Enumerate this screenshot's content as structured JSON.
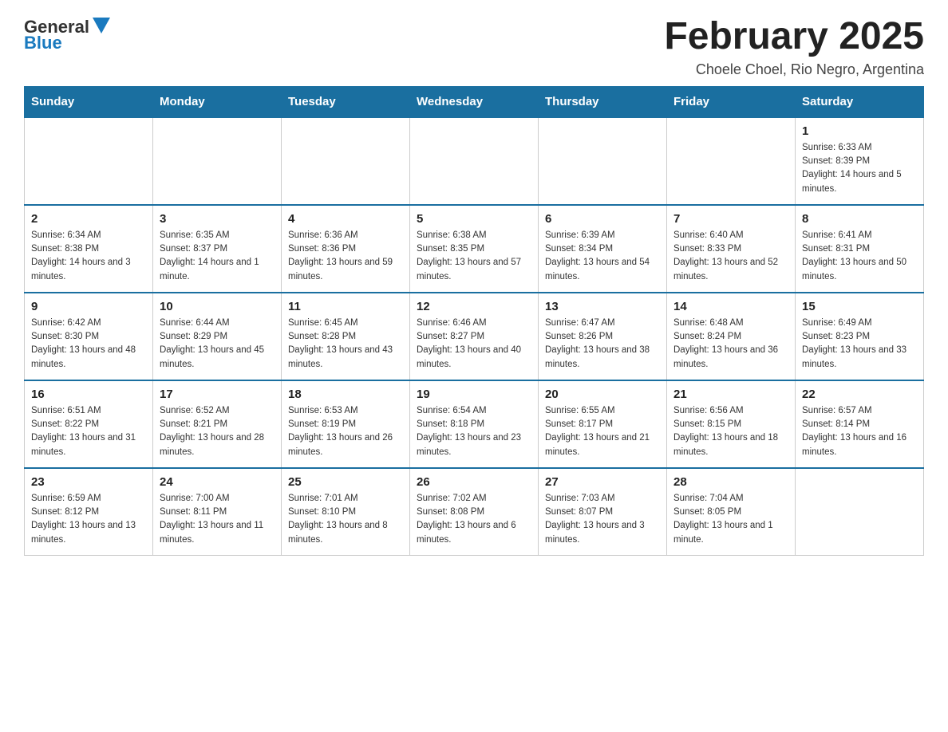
{
  "header": {
    "logo_general": "General",
    "logo_blue": "Blue",
    "month_title": "February 2025",
    "location": "Choele Choel, Rio Negro, Argentina"
  },
  "weekdays": [
    "Sunday",
    "Monday",
    "Tuesday",
    "Wednesday",
    "Thursday",
    "Friday",
    "Saturday"
  ],
  "weeks": [
    [
      {
        "day": "",
        "info": ""
      },
      {
        "day": "",
        "info": ""
      },
      {
        "day": "",
        "info": ""
      },
      {
        "day": "",
        "info": ""
      },
      {
        "day": "",
        "info": ""
      },
      {
        "day": "",
        "info": ""
      },
      {
        "day": "1",
        "info": "Sunrise: 6:33 AM\nSunset: 8:39 PM\nDaylight: 14 hours and 5 minutes."
      }
    ],
    [
      {
        "day": "2",
        "info": "Sunrise: 6:34 AM\nSunset: 8:38 PM\nDaylight: 14 hours and 3 minutes."
      },
      {
        "day": "3",
        "info": "Sunrise: 6:35 AM\nSunset: 8:37 PM\nDaylight: 14 hours and 1 minute."
      },
      {
        "day": "4",
        "info": "Sunrise: 6:36 AM\nSunset: 8:36 PM\nDaylight: 13 hours and 59 minutes."
      },
      {
        "day": "5",
        "info": "Sunrise: 6:38 AM\nSunset: 8:35 PM\nDaylight: 13 hours and 57 minutes."
      },
      {
        "day": "6",
        "info": "Sunrise: 6:39 AM\nSunset: 8:34 PM\nDaylight: 13 hours and 54 minutes."
      },
      {
        "day": "7",
        "info": "Sunrise: 6:40 AM\nSunset: 8:33 PM\nDaylight: 13 hours and 52 minutes."
      },
      {
        "day": "8",
        "info": "Sunrise: 6:41 AM\nSunset: 8:31 PM\nDaylight: 13 hours and 50 minutes."
      }
    ],
    [
      {
        "day": "9",
        "info": "Sunrise: 6:42 AM\nSunset: 8:30 PM\nDaylight: 13 hours and 48 minutes."
      },
      {
        "day": "10",
        "info": "Sunrise: 6:44 AM\nSunset: 8:29 PM\nDaylight: 13 hours and 45 minutes."
      },
      {
        "day": "11",
        "info": "Sunrise: 6:45 AM\nSunset: 8:28 PM\nDaylight: 13 hours and 43 minutes."
      },
      {
        "day": "12",
        "info": "Sunrise: 6:46 AM\nSunset: 8:27 PM\nDaylight: 13 hours and 40 minutes."
      },
      {
        "day": "13",
        "info": "Sunrise: 6:47 AM\nSunset: 8:26 PM\nDaylight: 13 hours and 38 minutes."
      },
      {
        "day": "14",
        "info": "Sunrise: 6:48 AM\nSunset: 8:24 PM\nDaylight: 13 hours and 36 minutes."
      },
      {
        "day": "15",
        "info": "Sunrise: 6:49 AM\nSunset: 8:23 PM\nDaylight: 13 hours and 33 minutes."
      }
    ],
    [
      {
        "day": "16",
        "info": "Sunrise: 6:51 AM\nSunset: 8:22 PM\nDaylight: 13 hours and 31 minutes."
      },
      {
        "day": "17",
        "info": "Sunrise: 6:52 AM\nSunset: 8:21 PM\nDaylight: 13 hours and 28 minutes."
      },
      {
        "day": "18",
        "info": "Sunrise: 6:53 AM\nSunset: 8:19 PM\nDaylight: 13 hours and 26 minutes."
      },
      {
        "day": "19",
        "info": "Sunrise: 6:54 AM\nSunset: 8:18 PM\nDaylight: 13 hours and 23 minutes."
      },
      {
        "day": "20",
        "info": "Sunrise: 6:55 AM\nSunset: 8:17 PM\nDaylight: 13 hours and 21 minutes."
      },
      {
        "day": "21",
        "info": "Sunrise: 6:56 AM\nSunset: 8:15 PM\nDaylight: 13 hours and 18 minutes."
      },
      {
        "day": "22",
        "info": "Sunrise: 6:57 AM\nSunset: 8:14 PM\nDaylight: 13 hours and 16 minutes."
      }
    ],
    [
      {
        "day": "23",
        "info": "Sunrise: 6:59 AM\nSunset: 8:12 PM\nDaylight: 13 hours and 13 minutes."
      },
      {
        "day": "24",
        "info": "Sunrise: 7:00 AM\nSunset: 8:11 PM\nDaylight: 13 hours and 11 minutes."
      },
      {
        "day": "25",
        "info": "Sunrise: 7:01 AM\nSunset: 8:10 PM\nDaylight: 13 hours and 8 minutes."
      },
      {
        "day": "26",
        "info": "Sunrise: 7:02 AM\nSunset: 8:08 PM\nDaylight: 13 hours and 6 minutes."
      },
      {
        "day": "27",
        "info": "Sunrise: 7:03 AM\nSunset: 8:07 PM\nDaylight: 13 hours and 3 minutes."
      },
      {
        "day": "28",
        "info": "Sunrise: 7:04 AM\nSunset: 8:05 PM\nDaylight: 13 hours and 1 minute."
      },
      {
        "day": "",
        "info": ""
      }
    ]
  ]
}
